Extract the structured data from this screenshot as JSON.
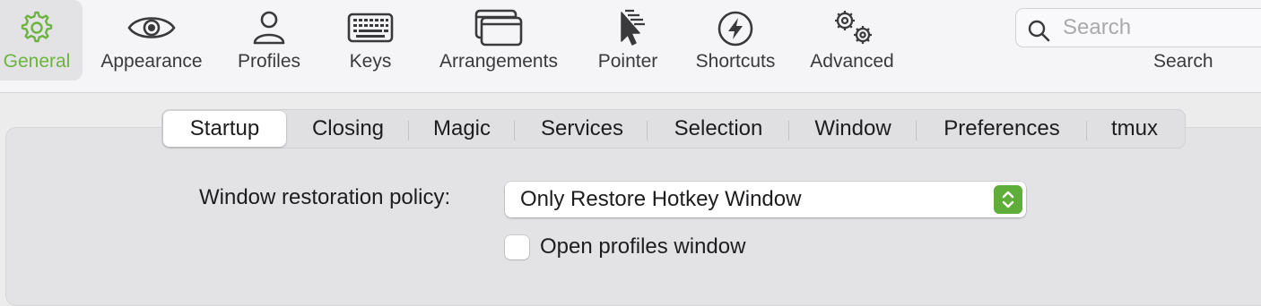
{
  "toolbar": {
    "items": [
      {
        "label": "General",
        "icon": "gear-icon",
        "selected": true
      },
      {
        "label": "Appearance",
        "icon": "eye-icon",
        "selected": false
      },
      {
        "label": "Profiles",
        "icon": "person-icon",
        "selected": false
      },
      {
        "label": "Keys",
        "icon": "keyboard-icon",
        "selected": false
      },
      {
        "label": "Arrangements",
        "icon": "windows-icon",
        "selected": false
      },
      {
        "label": "Pointer",
        "icon": "pointer-icon",
        "selected": false
      },
      {
        "label": "Shortcuts",
        "icon": "bolt-icon",
        "selected": false
      },
      {
        "label": "Advanced",
        "icon": "gears-icon",
        "selected": false
      }
    ],
    "search": {
      "placeholder": "Search",
      "value": "",
      "caption": "Search"
    }
  },
  "tabs": {
    "items": [
      "Startup",
      "Closing",
      "Magic",
      "Services",
      "Selection",
      "Window",
      "Preferences",
      "tmux"
    ],
    "active": "Startup"
  },
  "startup": {
    "restoration_label": "Window restoration policy:",
    "restoration_value": "Only Restore Hotkey Window",
    "open_profiles_label": "Open profiles window",
    "open_profiles_checked": false
  },
  "colors": {
    "accent": "#6cb33f",
    "stepper": "#5fae3a",
    "toolbar_bg": "#f5f5f7",
    "content_bg": "#ececec"
  }
}
